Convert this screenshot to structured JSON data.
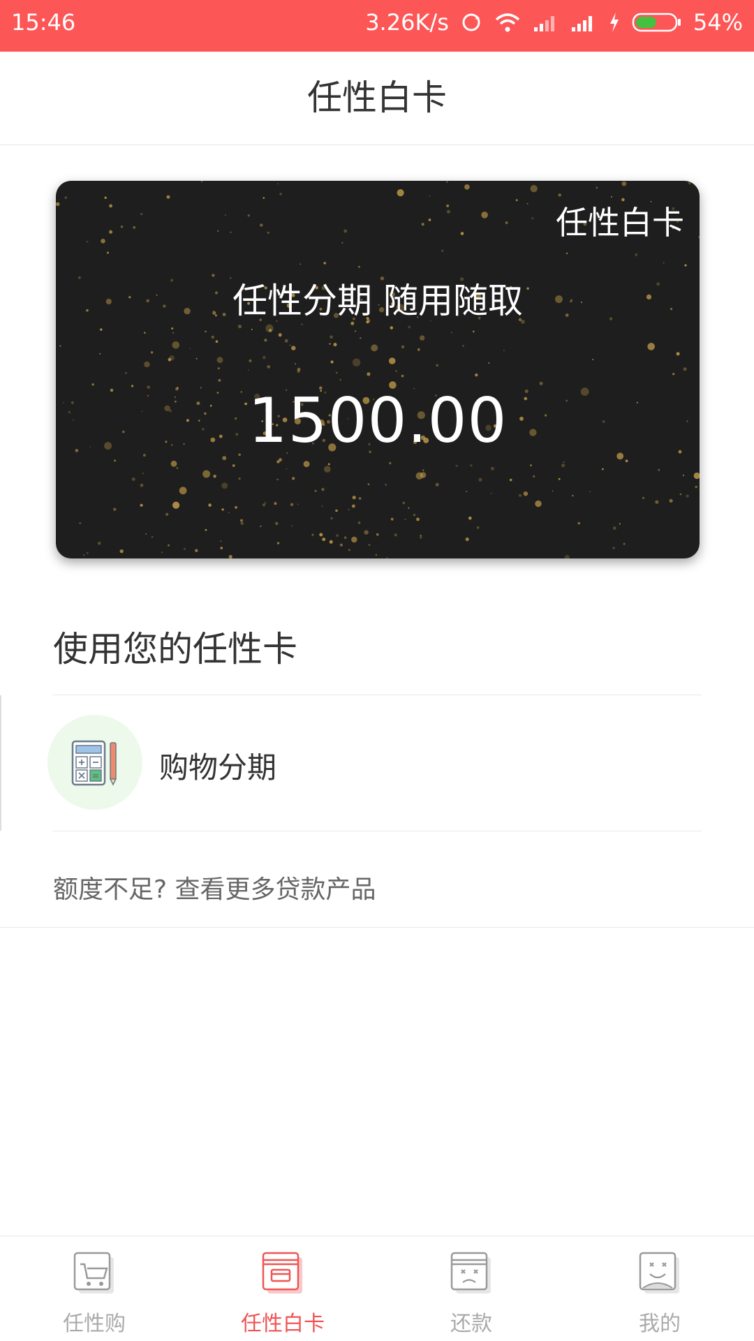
{
  "status_bar": {
    "time": "15:46",
    "net_speed": "3.26K/s",
    "battery": "54%",
    "battery_level": 0.54,
    "icons": [
      "sync-icon",
      "wifi-icon",
      "signal-icon",
      "signal-icon",
      "charging-icon",
      "battery-icon"
    ]
  },
  "header": {
    "title": "任性白卡"
  },
  "card": {
    "brand": "任性白卡",
    "slogan": "任性分期  随用随取",
    "amount": "1500.00"
  },
  "section": {
    "heading": "使用您的任性卡",
    "items": [
      {
        "label": "购物分期",
        "icon": "calculator-icon"
      }
    ],
    "more_link": "额度不足? 查看更多贷款产品"
  },
  "bottom_nav": {
    "tabs": [
      {
        "label": "任性购",
        "icon": "shopping-cart-icon",
        "active": false
      },
      {
        "label": "任性白卡",
        "icon": "card-icon",
        "active": true
      },
      {
        "label": "还款",
        "icon": "repay-icon",
        "active": false
      },
      {
        "label": "我的",
        "icon": "profile-icon",
        "active": false
      }
    ]
  },
  "colors": {
    "accent": "#fd5656",
    "card_bg": "#1e1e1e",
    "speckle": "#c9a24a",
    "icon_bg": "#edf9ea"
  }
}
